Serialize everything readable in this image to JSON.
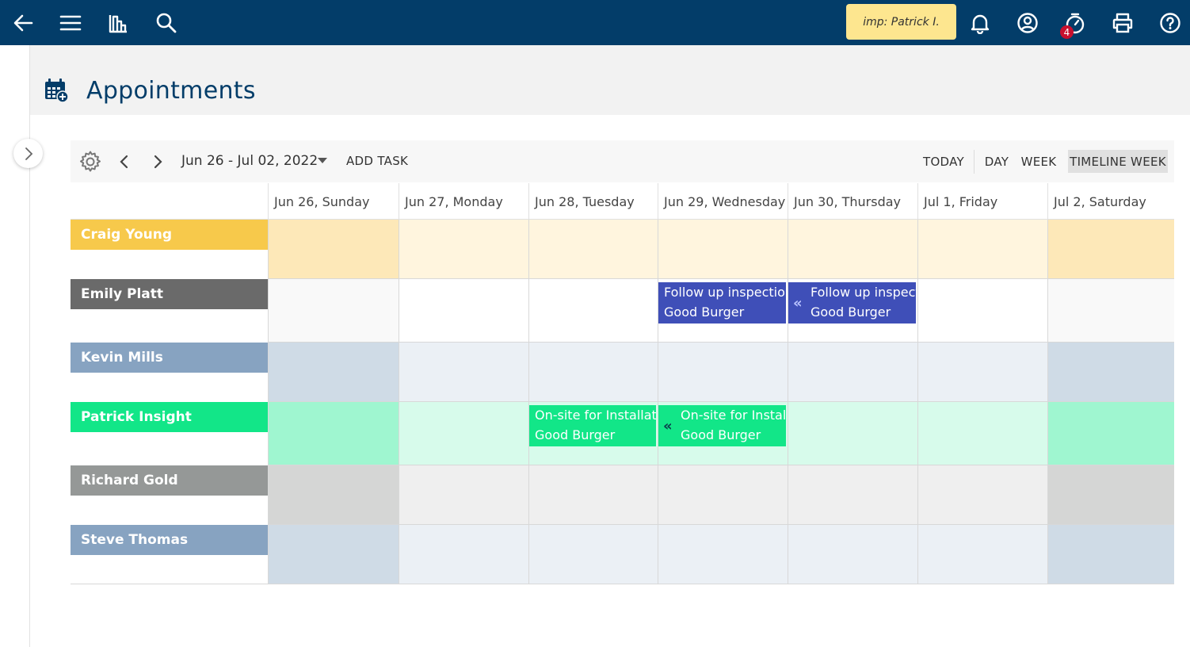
{
  "topbar": {
    "impersonation_label": "imp: Patrick I.",
    "timer_badge_count": "4",
    "icons": [
      "back-arrow-icon",
      "menu-icon",
      "reports-icon",
      "search-icon",
      "bell-icon",
      "account-icon",
      "timer-icon",
      "print-icon",
      "help-icon"
    ]
  },
  "page": {
    "title": "Appointments"
  },
  "toolbar": {
    "date_range": "Jun 26 - Jul 02, 2022",
    "add_task": "ADD TASK",
    "today": "TODAY",
    "day": "DAY",
    "week": "WEEK",
    "timeline_week": "TIMELINE WEEK",
    "active_view": "TIMELINE WEEK"
  },
  "days": [
    "Jun 26, Sunday",
    "Jun 27, Monday",
    "Jun 28, Tuesday",
    "Jun 29, Wednesday",
    "Jun 30, Thursday",
    "Jul 1, Friday",
    "Jul 2, Saturday"
  ],
  "resources": [
    {
      "name": "Craig Young",
      "color": "#f7c94b",
      "weekday_bg": "#fff5de",
      "weekend_bg": "#fde8b8"
    },
    {
      "name": "Emily Platt",
      "color": "#6a6a6a",
      "weekday_bg": "#ffffff",
      "weekend_bg": "#f9f9f9"
    },
    {
      "name": "Kevin Mills",
      "color": "#87a3c1",
      "weekday_bg": "#ebf0f5",
      "weekend_bg": "#cfdbe6"
    },
    {
      "name": "Patrick Insight",
      "color": "#12e688",
      "weekday_bg": "#d7fbeb",
      "weekend_bg": "#9ff6d0"
    },
    {
      "name": "Richard Gold",
      "color": "#959897",
      "weekday_bg": "#efefef",
      "weekend_bg": "#d5d6d5"
    },
    {
      "name": "Steve Thomas",
      "color": "#87a3c1",
      "weekday_bg": "#ebf0f5",
      "weekend_bg": "#cfdbe6"
    }
  ],
  "appointments": [
    {
      "resource": "Emily Platt",
      "day": "Jun 29, Wednesday",
      "title": "Follow up inspection",
      "customer": "Good Burger",
      "color": "#3f4fb8",
      "continued": false
    },
    {
      "resource": "Emily Platt",
      "day": "Jun 30, Thursday",
      "title": "Follow up inspection",
      "customer": "Good Burger",
      "color": "#3f4fb8",
      "continued": true
    },
    {
      "resource": "Patrick Insight",
      "day": "Jun 28, Tuesday",
      "title": "On-site for Installation",
      "customer": "Good Burger",
      "color": "#12e688",
      "continued": false
    },
    {
      "resource": "Patrick Insight",
      "day": "Jun 29, Wednesday",
      "title": "On-site for Installation",
      "customer": "Good Burger",
      "color": "#12e688",
      "continued": true
    }
  ]
}
